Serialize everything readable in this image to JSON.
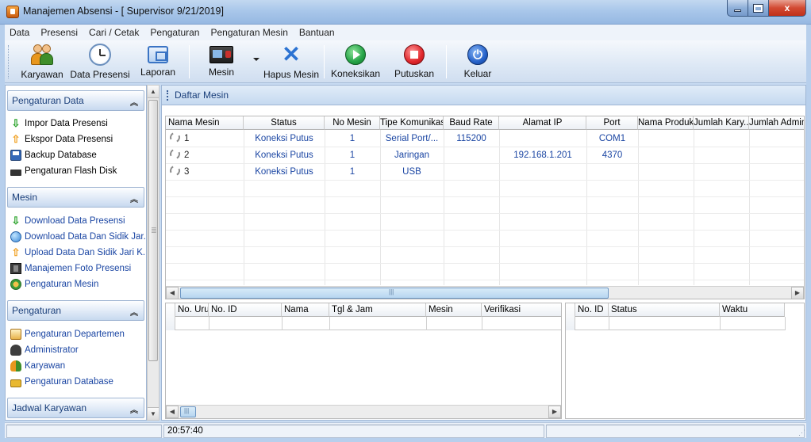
{
  "window": {
    "title": "Manajemen Absensi - [ Supervisor 9/21/2019]",
    "minimize_glyph": "",
    "close_glyph": "x"
  },
  "menu": [
    "Data",
    "Presensi",
    "Cari / Cetak",
    "Pengaturan",
    "Pengaturan Mesin",
    "Bantuan"
  ],
  "toolbar": {
    "karyawan": "Karyawan",
    "data_presensi": "Data Presensi",
    "laporan": "Laporan",
    "mesin": "Mesin",
    "hapus_mesin": "Hapus Mesin",
    "koneksikan": "Koneksikan",
    "putuskan": "Putuskan",
    "keluar": "Keluar"
  },
  "sidebar": {
    "groups": [
      {
        "title": "Pengaturan Data",
        "items": [
          "Impor Data Presensi",
          "Ekspor Data Presensi",
          "Backup Database",
          "Pengaturan Flash Disk"
        ]
      },
      {
        "title": "Mesin",
        "items": [
          "Download Data Presensi",
          "Download Data Dan Sidik Jar...",
          "Upload Data Dan Sidik Jari K...",
          "Manajemen Foto Presensi",
          "Pengaturan Mesin"
        ]
      },
      {
        "title": "Pengaturan",
        "items": [
          "Pengaturan Departemen",
          "Administrator",
          "Karyawan",
          "Pengaturan Database"
        ]
      },
      {
        "title": "Jadwal Karyawan",
        "items": []
      }
    ]
  },
  "main": {
    "header": "Daftar Mesin",
    "columns": [
      "Nama Mesin",
      "Status",
      "No Mesin",
      "Tipe Komunikasi",
      "Baud Rate",
      "Alamat IP",
      "Port",
      "Nama Produk",
      "Jumlah Kary...",
      "Jumlah Admin"
    ],
    "rows": [
      {
        "name": "1",
        "status": "Koneksi Putus",
        "no": "1",
        "tipe": "Serial Port/...",
        "baud": "115200",
        "ip": "",
        "port": "COM1"
      },
      {
        "name": "2",
        "status": "Koneksi Putus",
        "no": "1",
        "tipe": "Jaringan",
        "baud": "",
        "ip": "192.168.1.201",
        "port": "4370"
      },
      {
        "name": "3",
        "status": "Koneksi Putus",
        "no": "1",
        "tipe": "USB",
        "baud": "",
        "ip": "",
        "port": ""
      }
    ],
    "presence_columns": [
      "No. Urut",
      "No. ID",
      "Nama",
      "Tgl & Jam",
      "Mesin",
      "Verifikasi"
    ],
    "log_columns": [
      "No. ID",
      "Status",
      "Waktu"
    ]
  },
  "statusbar": {
    "time": "20:57:40"
  },
  "colors": {
    "accent": "#1b46a3",
    "toolbar_bg": "#dde8f5",
    "title_bg": "#a9c7ea"
  }
}
